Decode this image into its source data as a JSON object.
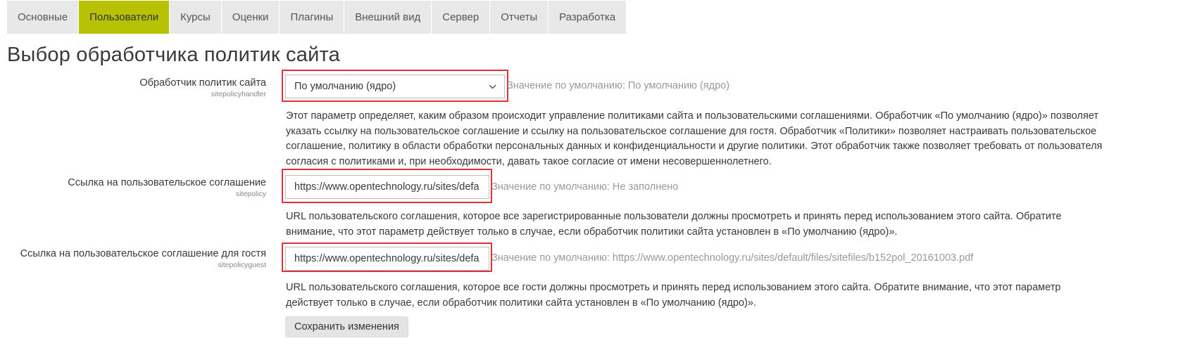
{
  "tabs": [
    {
      "label": "Основные",
      "active": false
    },
    {
      "label": "Пользователи",
      "active": true
    },
    {
      "label": "Курсы",
      "active": false
    },
    {
      "label": "Оценки",
      "active": false
    },
    {
      "label": "Плагины",
      "active": false
    },
    {
      "label": "Внешний вид",
      "active": false
    },
    {
      "label": "Сервер",
      "active": false
    },
    {
      "label": "Отчеты",
      "active": false
    },
    {
      "label": "Разработка",
      "active": false
    }
  ],
  "page_title": "Выбор обработчика политик сайта",
  "settings": {
    "handler": {
      "label": "Обработчик политик сайта",
      "key": "sitepolicyhandler",
      "selected": "По умолчанию (ядро)",
      "default_text": "Значение по умолчанию: По умолчанию (ядро)",
      "description": "Этот параметр определяет, каким образом происходит управление политиками сайта и пользовательскими соглашениями. Обработчик «По умолчанию (ядро)» позволяет указать ссылку на пользовательское соглашение и ссылку на пользовательское соглашение для гостя. Обработчик «Политики» позволяет настраивать пользовательское соглашение, политику в области обработки персональных данных и конфиденциальности и другие политики. Этот обработчик также позволяет требовать от пользователя согласия с политиками и, при необходимости, давать такое согласие от имени несовершеннолетнего."
    },
    "sitepolicy": {
      "label": "Ссылка на пользовательское соглашение",
      "key": "sitepolicy",
      "value": "https://www.opentechnology.ru/sites/defa",
      "default_text": "Значение по умолчанию: Не заполнено",
      "description": "URL пользовательского соглашения, которое все зарегистрированные пользователи должны просмотреть и принять перед использованием этого сайта. Обратите внимание, что этот параметр действует только в случае, если обработчик политики сайта установлен в «По умолчанию (ядро)»."
    },
    "sitepolicyguest": {
      "label": "Ссылка на пользовательское соглашение для гостя",
      "key": "sitepolicyguest",
      "value": "https://www.opentechnology.ru/sites/defa",
      "default_text": "Значение по умолчанию: https://www.opentechnology.ru/sites/default/files/sitefiles/b152pol_20161003.pdf",
      "description": "URL пользовательского соглашения, которое все гости должны просмотреть и принять перед использованием этого сайта. Обратите внимание, что этот параметр действует только в случае, если обработчик политики сайта установлен в «По умолчанию (ядро)»."
    }
  },
  "save_button": "Сохранить изменения",
  "colors": {
    "active_tab": "#b7c205",
    "highlight": "#e0313b"
  },
  "icons": {
    "select_arrow": "chevron-down-icon"
  }
}
